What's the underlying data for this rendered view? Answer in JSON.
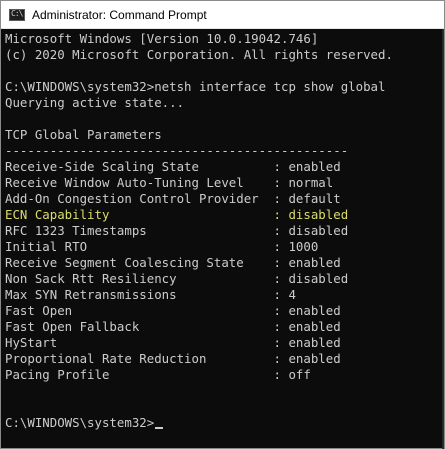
{
  "window": {
    "title": "Administrator: Command Prompt",
    "icon": "cmd-icon",
    "icon_glyph": "C:\\"
  },
  "console": {
    "header_lines": [
      "Microsoft Windows [Version 10.0.19042.746]",
      "(c) 2020 Microsoft Corporation. All rights reserved."
    ],
    "command_line": "C:\\WINDOWS\\system32>netsh interface tcp show global",
    "status_line": "Querying active state...",
    "section_title": "TCP Global Parameters",
    "separator": "----------------------------------------------",
    "parameters": [
      "Receive-Side Scaling State          : enabled",
      "Receive Window Auto-Tuning Level    : normal",
      "Add-On Congestion Control Provider  : default",
      "ECN Capability                      : disabled",
      "RFC 1323 Timestamps                 : disabled",
      "Initial RTO                         : 1000",
      "Receive Segment Coalescing State    : enabled",
      "Non Sack Rtt Resiliency             : disabled",
      "Max SYN Retransmissions             : 4",
      "Fast Open                           : enabled",
      "Fast Open Fallback                  : enabled",
      "HyStart                             : enabled",
      "Proportional Rate Reduction         : enabled",
      "Pacing Profile                      : off"
    ],
    "highlighted_parameter_index": 3,
    "prompt": "C:\\WINDOWS\\system32>",
    "colors": {
      "background": "#0c0c0c",
      "text": "#cccccc",
      "highlight": "#dcdc6a"
    }
  }
}
